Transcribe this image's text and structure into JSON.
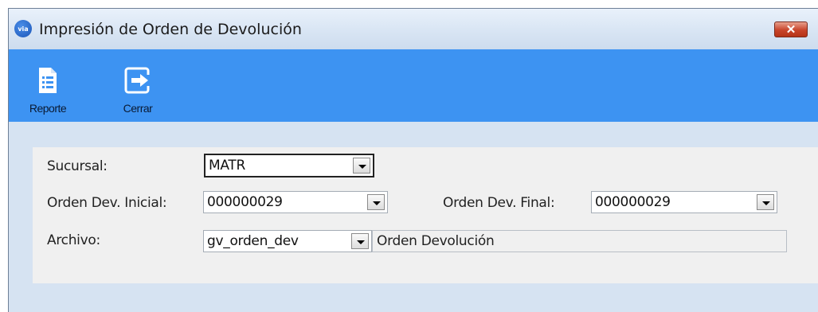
{
  "window": {
    "title": "Impresión de Orden de Devolución",
    "app_icon_text": "via"
  },
  "toolbar": {
    "buttons": [
      {
        "label": "Reporte",
        "icon": "report-icon"
      },
      {
        "label": "Cerrar",
        "icon": "exit-icon"
      }
    ]
  },
  "form": {
    "sucursal": {
      "label": "Sucursal:",
      "value": "MATR"
    },
    "orden_inicial": {
      "label": "Orden Dev. Inicial:",
      "value": "000000029"
    },
    "orden_final": {
      "label": "Orden Dev. Final:",
      "value": "000000029"
    },
    "archivo": {
      "label": "Archivo:",
      "value": "gv_orden_dev",
      "description": "Orden Devolución"
    }
  },
  "colors": {
    "toolbar": "#3d93f2",
    "window_bg": "#d6e3f2",
    "panel_bg": "#f0f0f0",
    "close_button": "#c8442a"
  }
}
